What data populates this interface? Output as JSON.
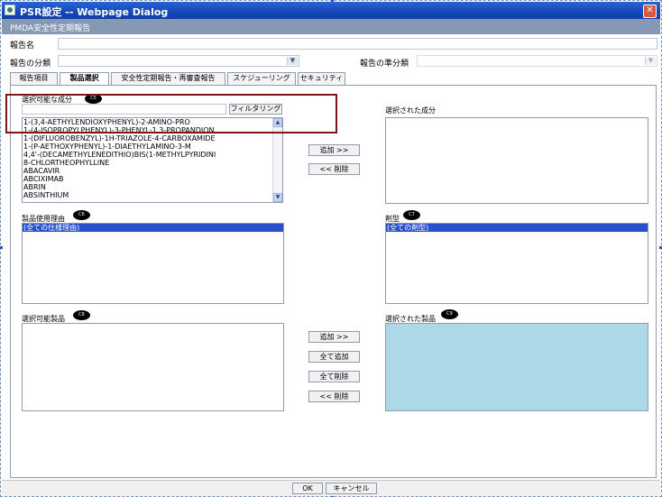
{
  "window": {
    "title": "PSR設定 -- Webpage Dialog",
    "close_glyph": "✕"
  },
  "header": {
    "subtitle": "PMDA安全性定期報告"
  },
  "form": {
    "report_name_label": "報告名",
    "report_name_value": "",
    "report_category_label": "報告の分類",
    "report_category_value": "",
    "report_standard_label": "報告の準分類",
    "report_standard_value": ""
  },
  "tabs": [
    {
      "label": "報告項目"
    },
    {
      "label": "製品選択"
    },
    {
      "label": "安全性定期報告・再審査報告"
    },
    {
      "label": "スケジューリング"
    },
    {
      "label": "セキュリティ"
    }
  ],
  "active_tab": "製品選択",
  "ingredients": {
    "available_label": "選択可能な成分",
    "badge": "C5",
    "filter_value": "",
    "filter_button": "フィルタリング",
    "items": [
      "1-(3,4-AETHYLENDIOXYPHENYL)-2-AMINO-PRO",
      "1-(4-ISOPROPYLPHENYL)-3-PHENYL-1,3-PROPANDION",
      "1-(DIFLUOROBENZYL)-1H-TRIAZOLE-4-CARBOXAMIDE",
      "1-(P-AETHOXYPHENYL)-1-DIAETHYLAMINO-3-M",
      "4,4'-(DECAMETHYLENEDITHIO)BIS(1-METHYLPYRIDINI",
      "8-CHLORTHEOPHYLLINE",
      "ABACAVIR",
      "ABCIXIMAB",
      "ABRIN",
      "ABSINTHIUM"
    ],
    "add_button": "追加 >>",
    "remove_button": "<< 削除",
    "selected_label": "選択された成分"
  },
  "reasons": {
    "label": "製品使用理由",
    "badge": "C6",
    "items": [
      "(全ての仕様理由)"
    ]
  },
  "dosage": {
    "label": "剤型",
    "badge": "C7",
    "items": [
      "(全ての剤型)"
    ]
  },
  "products": {
    "available_label": "選択可能製品",
    "badge": "C8",
    "selected_label": "選択された製品",
    "selected_badge": "C9",
    "add_button": "追加 >>",
    "add_all_button": "全て追加",
    "remove_all_button": "全て削除",
    "remove_button": "<< 削除"
  },
  "footer": {
    "ok_button": "OK",
    "cancel_button": "キャンセル"
  },
  "colors": {
    "titlebar": "#1548b8",
    "subbar": "#8598b4",
    "selection": "#2850c8",
    "selected_products_bg": "#add8e6",
    "highlight_box": "#7c1717"
  }
}
